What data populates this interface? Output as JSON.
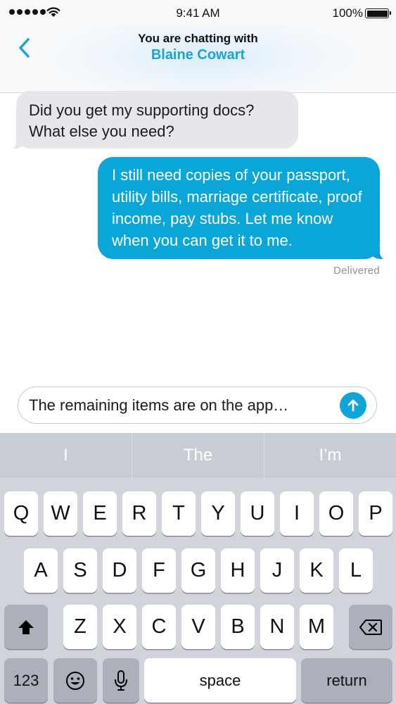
{
  "status_bar": {
    "time": "9:41 AM",
    "battery": "100%",
    "battery_level": 1.0
  },
  "header": {
    "subtitle": "You are chatting with",
    "contact_name": "Blaine Cowart"
  },
  "messages": [
    {
      "direction": "incoming",
      "text": "Did you get my supporting docs? What else you need?"
    },
    {
      "direction": "outgoing",
      "text": "I still need copies of your passport, utility bills, marriage certificate, proof income, pay stubs. Let me know when you can get it to me."
    }
  ],
  "delivery_status": "Delivered",
  "composer": {
    "text": "The remaining items are on the app…"
  },
  "keyboard": {
    "predictions": [
      "I",
      "The",
      "I’m"
    ],
    "row1": [
      "Q",
      "W",
      "E",
      "R",
      "T",
      "Y",
      "U",
      "I",
      "O",
      "P"
    ],
    "row2": [
      "A",
      "S",
      "D",
      "F",
      "G",
      "H",
      "J",
      "K",
      "L"
    ],
    "row3": [
      "Z",
      "X",
      "C",
      "V",
      "B",
      "N",
      "M"
    ],
    "numbers_label": "123",
    "space_label": "space",
    "return_label": "return"
  },
  "colors": {
    "accent": "#0aa6d8",
    "incoming_bubble": "#e6e6eb",
    "keyboard_bg": "#d1d5db"
  },
  "icons": [
    "back-chevron-icon",
    "send-arrow-icon",
    "shift-icon",
    "delete-icon",
    "emoji-icon",
    "microphone-icon",
    "wifi-icon",
    "battery-icon",
    "signal-icon"
  ]
}
